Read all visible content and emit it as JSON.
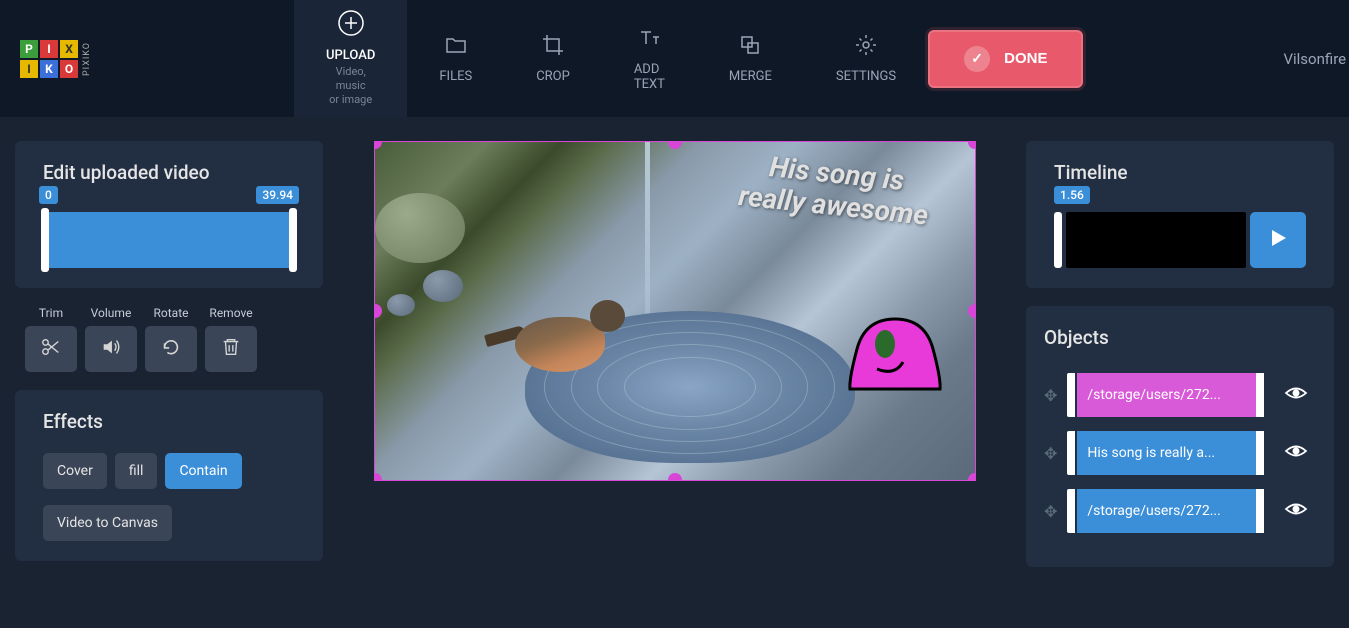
{
  "header": {
    "logo_text": "PIXIKO"
  },
  "nav": {
    "upload": {
      "label": "UPLOAD",
      "sub1": "Video, music",
      "sub2": "or image"
    },
    "files": "FILES",
    "crop": "CROP",
    "addtext": "ADD TEXT",
    "merge": "MERGE",
    "settings": "SETTINGS"
  },
  "done_label": "DONE",
  "user": "Vilsonfire",
  "leftPanel": {
    "editTitle": "Edit uploaded video",
    "sliderStart": "0",
    "sliderEnd": "39.94",
    "tools": {
      "trim": "Trim",
      "volume": "Volume",
      "rotate": "Rotate",
      "remove": "Remove"
    },
    "effectsTitle": "Effects",
    "effectBtns": {
      "cover": "Cover",
      "fill": "fill",
      "contain": "Contain",
      "videoToCanvas": "Video to Canvas"
    }
  },
  "canvas": {
    "overlayText1": "His song is",
    "overlayText2": "really awesome"
  },
  "timeline": {
    "title": "Timeline",
    "pos": "1.56"
  },
  "objects": {
    "title": "Objects",
    "items": [
      {
        "label": "/storage/users/272...",
        "color": "pink"
      },
      {
        "label": "His song is really a...",
        "color": "blue"
      },
      {
        "label": "/storage/users/272...",
        "color": "blue"
      }
    ]
  }
}
